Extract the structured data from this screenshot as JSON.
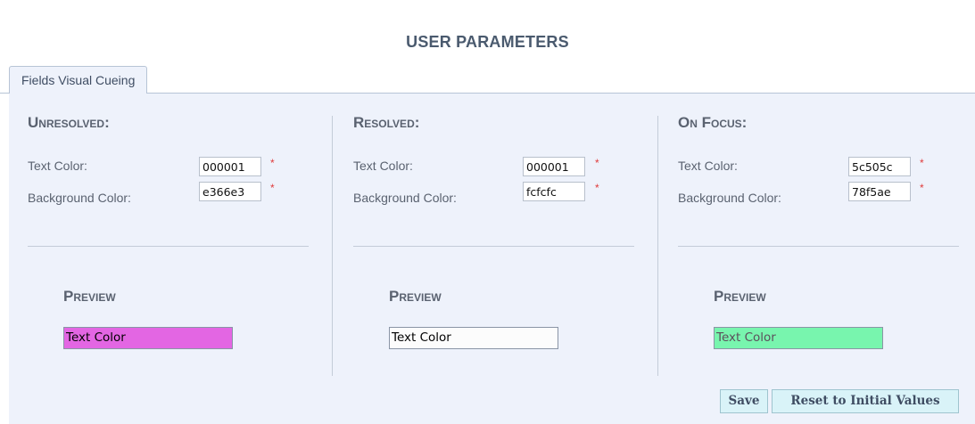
{
  "page": {
    "title": "USER PARAMETERS"
  },
  "tabs": [
    {
      "label": "Fields Visual Cueing"
    }
  ],
  "labels": {
    "text_color": "Text Color:",
    "background_color": "Background Color:",
    "preview": "Preview",
    "required_marker": "*",
    "preview_sample": "Text Color"
  },
  "sections": {
    "unresolved": {
      "title": "Unresolved:",
      "text_color": "000001",
      "background_color": "e366e3",
      "preview_text_hex": "#000001",
      "preview_bg_hex": "#e366e3"
    },
    "resolved": {
      "title": "Resolved:",
      "text_color": "000001",
      "background_color": "fcfcfc",
      "preview_text_hex": "#000001",
      "preview_bg_hex": "#fcfcfc"
    },
    "on_focus": {
      "title": "On Focus:",
      "text_color": "5c505c",
      "background_color": "78f5ae",
      "preview_text_hex": "#5c505c",
      "preview_bg_hex": "#78f5ae"
    }
  },
  "buttons": {
    "save": "Save",
    "reset": "Reset to Initial Values"
  },
  "colors": {
    "title": "#4a5a6e",
    "panel_bg": "#eef2fb",
    "required": "#e03b3b",
    "button_bg": "#d9f3f8"
  }
}
